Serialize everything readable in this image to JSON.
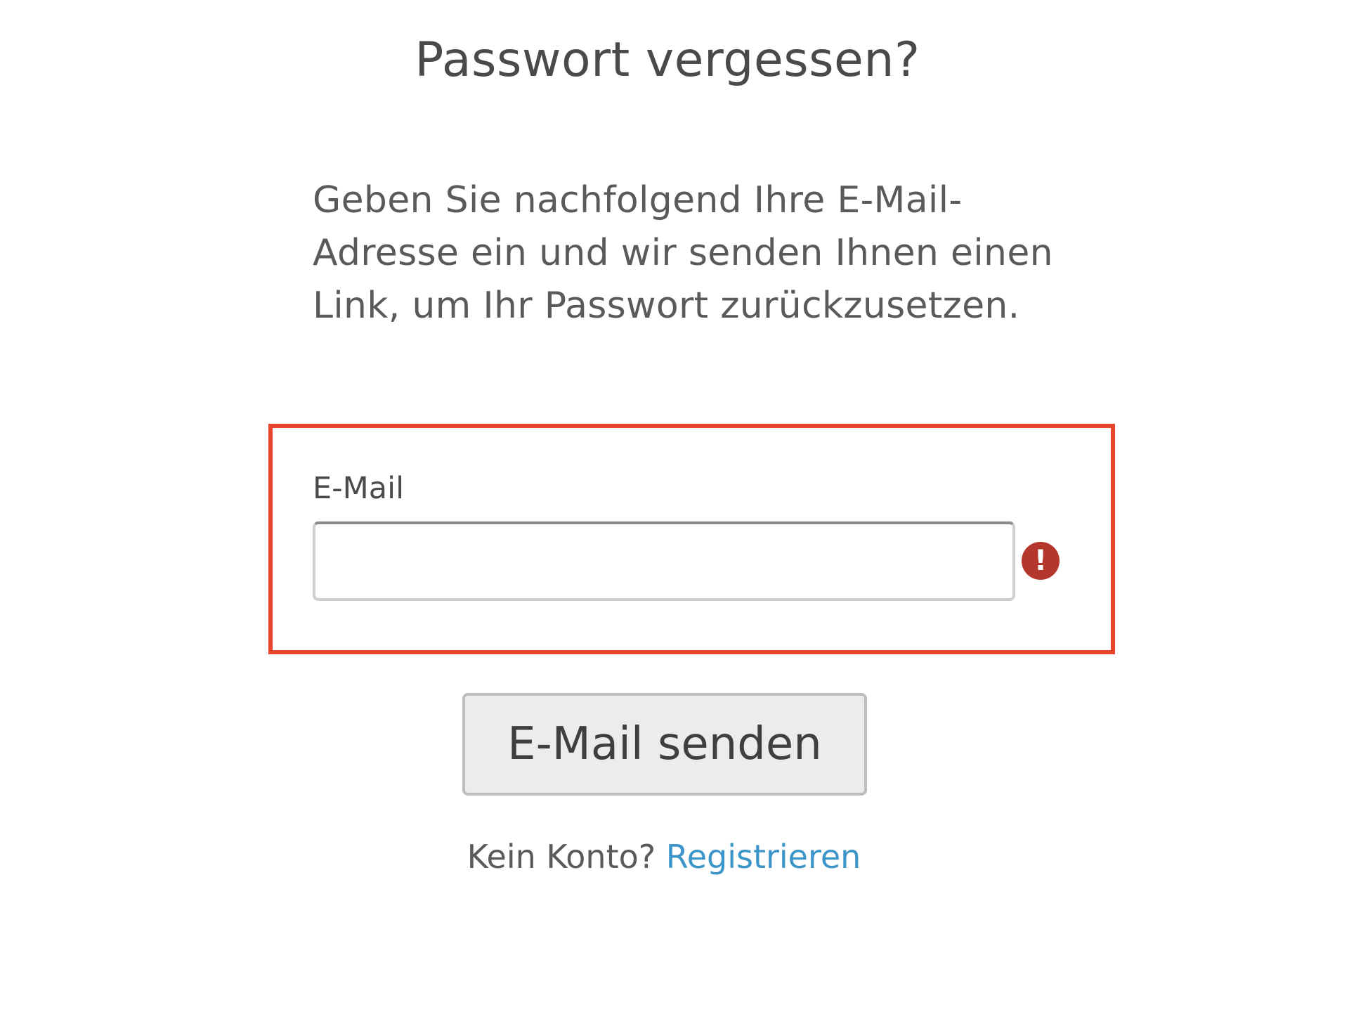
{
  "title": "Passwort vergessen?",
  "intro": {
    "lines": [
      "Geben Sie nachfolgend Ihre E-Mail-",
      "Adresse ein und wir senden Ihnen einen",
      "Link, um Ihr Passwort zurückzusetzen."
    ]
  },
  "email_field": {
    "label": "E-Mail",
    "value": "",
    "placeholder": "",
    "error_icon": "exclamation-icon",
    "error_icon_glyph": "!",
    "highlight_color": "#e8432d",
    "error_color": "#b5362a"
  },
  "send_button": {
    "label": "E-Mail senden"
  },
  "register": {
    "prompt": "Kein Konto?",
    "link_label": "Registrieren",
    "link_color": "#3c95c8"
  }
}
